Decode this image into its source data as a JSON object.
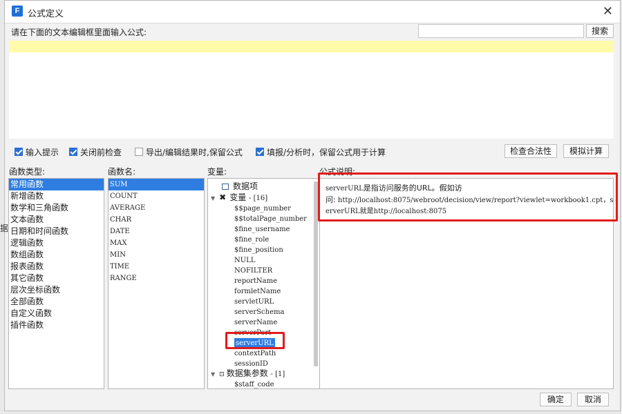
{
  "window": {
    "title": "公式定义",
    "app_icon_letter": "F",
    "close": "✕"
  },
  "prompt": "请在下面的文本编辑框里面输入公式:",
  "search": {
    "value": "",
    "button": "搜索"
  },
  "options": [
    {
      "label": "输入提示",
      "checked": true
    },
    {
      "label": "关闭前检查",
      "checked": true
    },
    {
      "label": "导出/编辑结果时,保留公式",
      "checked": false
    },
    {
      "label": "填报/分析时，保留公式用于计算",
      "checked": true
    }
  ],
  "buttons": {
    "check": "检查合法性",
    "simulate": "模拟计算",
    "ok": "确定",
    "cancel": "取消"
  },
  "columns": {
    "category": "函数类型:",
    "function": "函数名:",
    "variable": "变量:",
    "description": "公式说明:"
  },
  "categories": [
    "常用函数",
    "新增函数",
    "数学和三角函数",
    "文本函数",
    "日期和时间函数",
    "逻辑函数",
    "数组函数",
    "报表函数",
    "其它函数",
    "层次坐标函数",
    "全部函数",
    "自定义函数",
    "插件函数"
  ],
  "selected_category": 0,
  "functions": [
    "SUM",
    "COUNT",
    "AVERAGE",
    "CHAR",
    "DATE",
    "MAX",
    "MIN",
    "TIME",
    "RANGE"
  ],
  "selected_function": 0,
  "tree": {
    "root": "数据项",
    "variables_label": "变量",
    "variables_count": "- [16]",
    "variables": [
      "$$page_number",
      "$$totalPage_number",
      "$fine_username",
      "$fine_role",
      "$fine_position",
      "NULL",
      "NOFILTER",
      "reportName",
      "formletName",
      "servletURL",
      "serverSchema",
      "serverName",
      "serverPort",
      "serverURL",
      "contextPath",
      "sessionID"
    ],
    "selected_variable": "serverURL",
    "dataset_label": "数据集参数",
    "dataset_count": "- [1]",
    "dataset_params": [
      "$staff_code"
    ]
  },
  "description": {
    "line1_prefix": "serverURL",
    "line1_cn": "是指访问服务的URL。假如访",
    "line2_cn": "问:",
    "line2_rest": " http://localhost:8075/webroot/decision/view/report?viewlet=workbook1.cpt，serverURL就是http://localhost:8075"
  },
  "side_glyph": "据",
  "colors": {
    "selection": "#2e7de1",
    "highlight_box": "#e21b1b",
    "editor_line": "#fffbab"
  }
}
